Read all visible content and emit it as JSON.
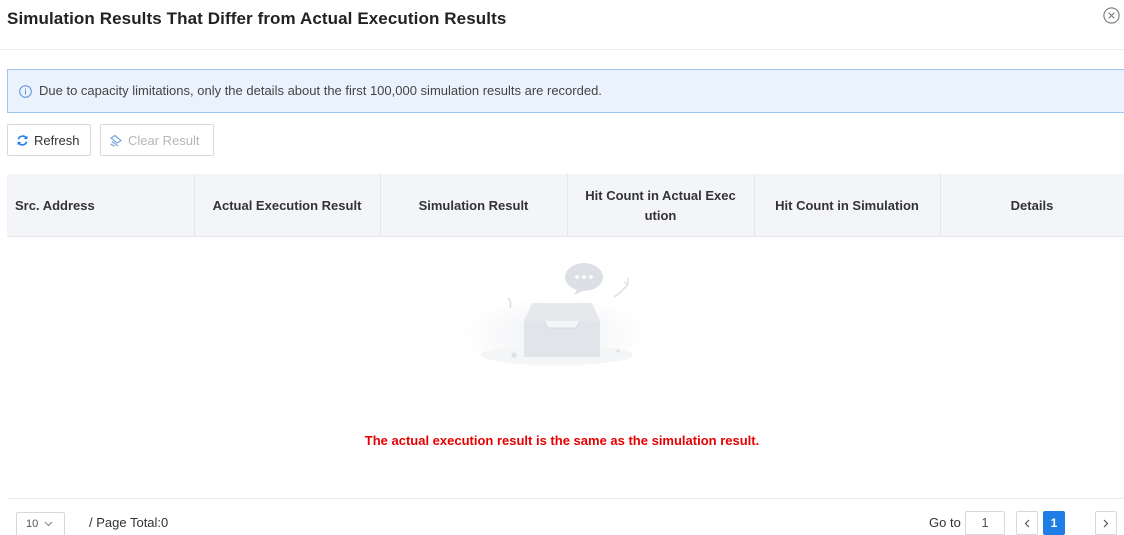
{
  "dialog": {
    "title": "Simulation Results That Differ from Actual Execution Results"
  },
  "info": {
    "text": "Due to capacity limitations, only the details about the first 100,000 simulation results are recorded."
  },
  "toolbar": {
    "refresh_label": "Refresh",
    "clear_label": "Clear Result"
  },
  "table": {
    "columns": [
      "Src. Address",
      "Actual Execution Result",
      "Simulation Result",
      "Hit Count in Actual Exec\nution",
      "Hit Count in Simulation",
      "Details"
    ],
    "rows": []
  },
  "empty": {
    "message": "The actual execution result is the same as the simulation result."
  },
  "pagination": {
    "page_size": "10",
    "page_total_text": "/ Page Total:0",
    "goto_label": "Go to",
    "goto_value": "1",
    "current_page": "1",
    "prev_icon": "chevron-left-icon",
    "next_icon": "chevron-right-icon"
  },
  "colors": {
    "accent": "#1f7de6",
    "info_bg": "#eaf3fd",
    "info_border": "#9fc6ee",
    "empty_message": "#e60000",
    "header_bg": "#f3f5f8"
  }
}
